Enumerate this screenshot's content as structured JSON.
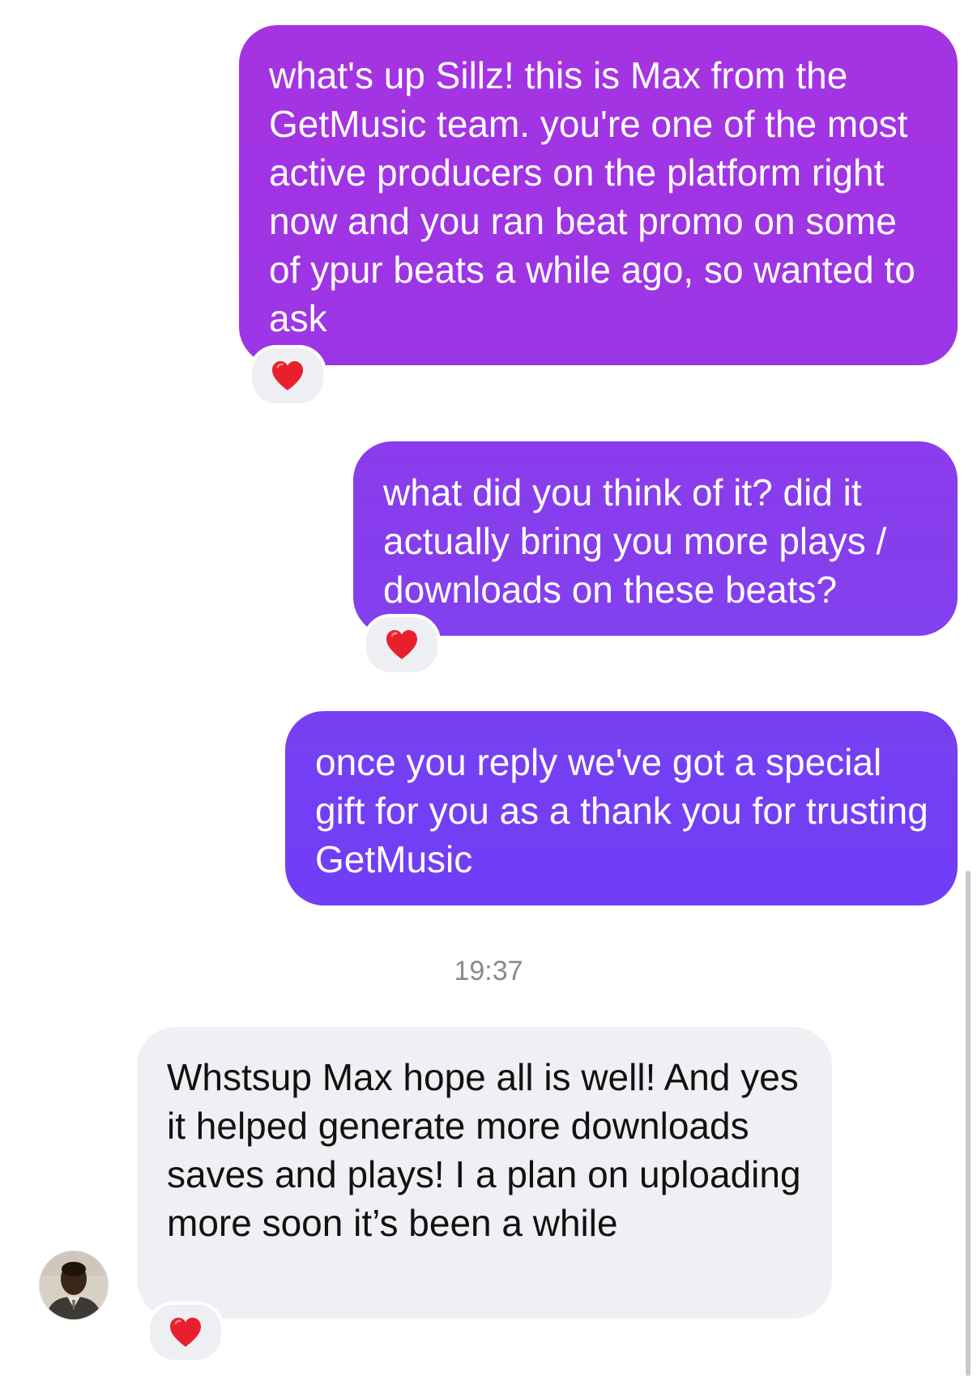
{
  "messages": [
    {
      "direction": "outgoing",
      "text": "what's up Sillz! this is Max from the GetMusic team. you're one of the most active producers on the platform right now and you ran beat promo on some of ypur beats a while ago, so wanted to ask",
      "reaction": "red-heart"
    },
    {
      "direction": "outgoing",
      "text": "what did you think of it? did it actually bring you more plays / downloads on these beats?",
      "reaction": "red-heart"
    },
    {
      "direction": "outgoing",
      "text": "once you reply we've got a special gift for you as a thank you for trusting GetMusic"
    },
    {
      "direction": "incoming",
      "text": "Whstsup Max hope all is well! And yes it helped generate more downloads saves and plays! I a plan on uploading more soon it’s been a while",
      "reaction": "red-heart"
    }
  ],
  "timestamp": "19:37",
  "colors": {
    "outgoing_top": "#a533e2",
    "outgoing_bottom": "#703ef6",
    "incoming_bubble": "#eff0f3",
    "reaction_heart": "#e8202e",
    "timestamp_text": "#8a8a8e"
  },
  "icons": {
    "reaction": "heart-icon",
    "avatar": "contact-avatar"
  }
}
